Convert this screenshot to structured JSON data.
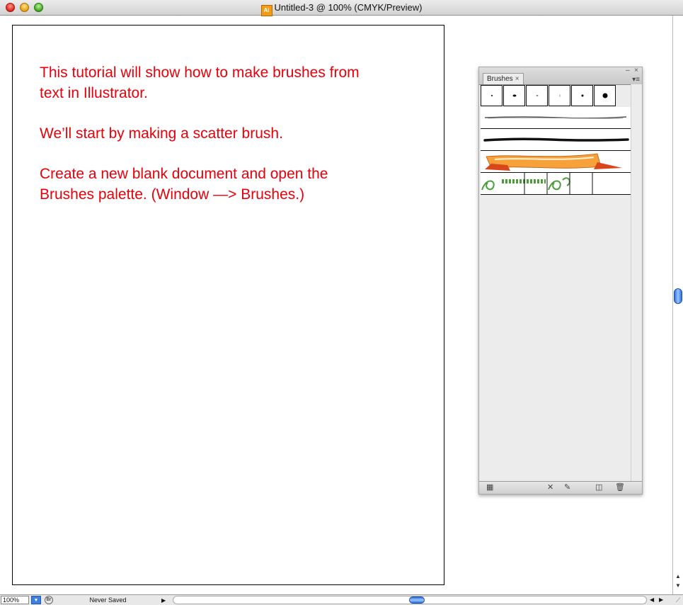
{
  "window": {
    "title": "Untitled-3 @ 100% (CMYK/Preview)",
    "doc_icon": "ai-document-icon",
    "doc_icon_text": "Ai"
  },
  "artboard": {
    "text_color": "#e8000b",
    "paragraphs": [
      "This tutorial will show how to make brushes from text in Illustrator.",
      "We’ll start by making a scatter brush.",
      "Create a new blank document and open the Brushes palette. (Window —> Brushes.)"
    ]
  },
  "brushes_palette": {
    "tab_label": "Brushes",
    "tab_close_glyph": "×",
    "collapse_glyph": "–",
    "close_glyph": "×",
    "menu_glyph": "▾≡",
    "calligraphic_brushes": [
      {
        "name": "calligraphic-1pt"
      },
      {
        "name": "calligraphic-3pt-oval"
      },
      {
        "name": "calligraphic-1pt-flat"
      },
      {
        "name": "calligraphic-1pt-thin"
      },
      {
        "name": "calligraphic-2pt"
      },
      {
        "name": "calligraphic-5pt"
      }
    ],
    "brush_rows": [
      "charcoal-feather-brush",
      "charcoal-brush",
      "ribbon-banner-art-brush",
      "green-ornament-pattern-brush"
    ],
    "footer_icons": [
      {
        "name": "brush-libraries-menu-icon",
        "glyph": "▦"
      },
      {
        "name": "remove-brush-stroke-icon",
        "glyph": "✕"
      },
      {
        "name": "brush-options-icon",
        "glyph": "✎"
      },
      {
        "name": "new-brush-icon",
        "glyph": "◫"
      },
      {
        "name": "delete-brush-icon",
        "glyph": "🗑"
      }
    ]
  },
  "status_bar": {
    "zoom": "100%",
    "zoom_dropdown_glyph": "▼",
    "bridge_glyph": "Br",
    "status_text": "Never Saved",
    "status_arrow": "▶",
    "left_arrow": "◀",
    "right_arrow": "▶",
    "grow_glyph": "⟋"
  },
  "vscroll": {
    "up_arrow": "▲",
    "down_arrow": "▼"
  }
}
